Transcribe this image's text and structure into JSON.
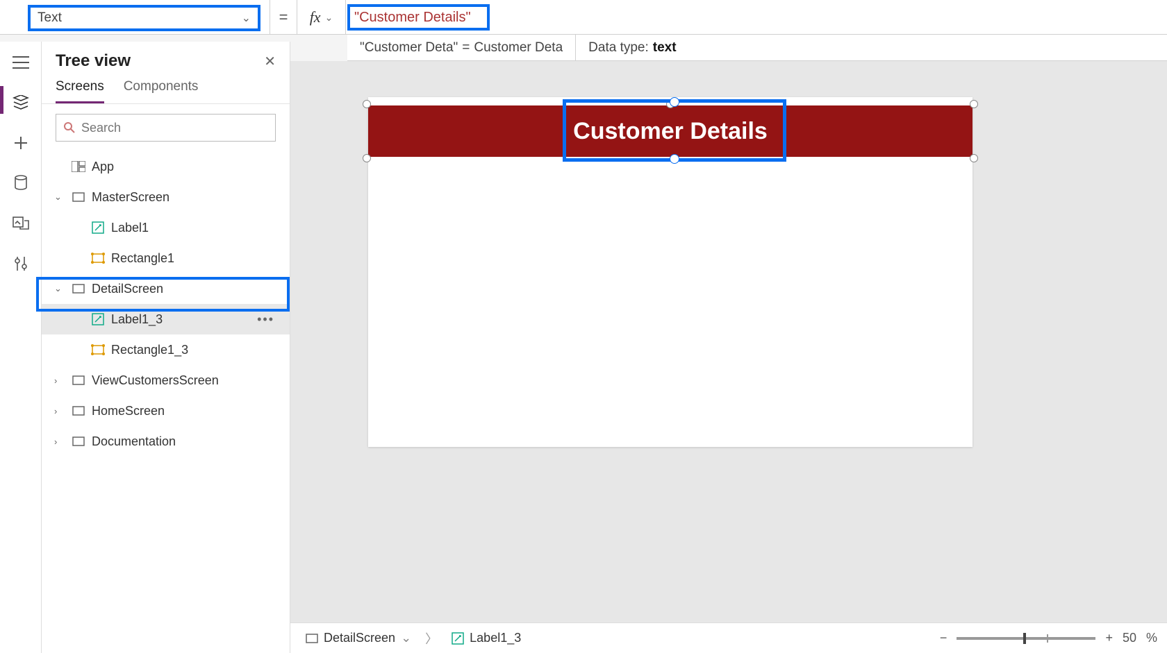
{
  "formula": {
    "property": "Text",
    "equals": "=",
    "fx": "fx",
    "value": "\"Customer Details\""
  },
  "intel": {
    "left_quoted": "\"Customer Deta\"",
    "left_eq": "=",
    "left_result": "Customer Deta",
    "right_label": "Data type:",
    "right_value": "text"
  },
  "tree": {
    "title": "Tree view",
    "tabs": {
      "screens": "Screens",
      "components": "Components"
    },
    "search_placeholder": "Search",
    "app": "App",
    "items": [
      {
        "name": "MasterScreen",
        "children": [
          {
            "name": "Label1",
            "icon": "label"
          },
          {
            "name": "Rectangle1",
            "icon": "rect"
          }
        ]
      },
      {
        "name": "DetailScreen",
        "children": [
          {
            "name": "Label1_3",
            "icon": "label",
            "selected": true
          },
          {
            "name": "Rectangle1_3",
            "icon": "rect"
          }
        ]
      },
      {
        "name": "ViewCustomersScreen"
      },
      {
        "name": "HomeScreen"
      },
      {
        "name": "Documentation"
      }
    ]
  },
  "canvas": {
    "header_text": "Customer Details"
  },
  "breadcrumb": {
    "screen": "DetailScreen",
    "control": "Label1_3"
  },
  "zoom": {
    "minus": "−",
    "plus": "+",
    "value": "50",
    "pct": "%"
  }
}
